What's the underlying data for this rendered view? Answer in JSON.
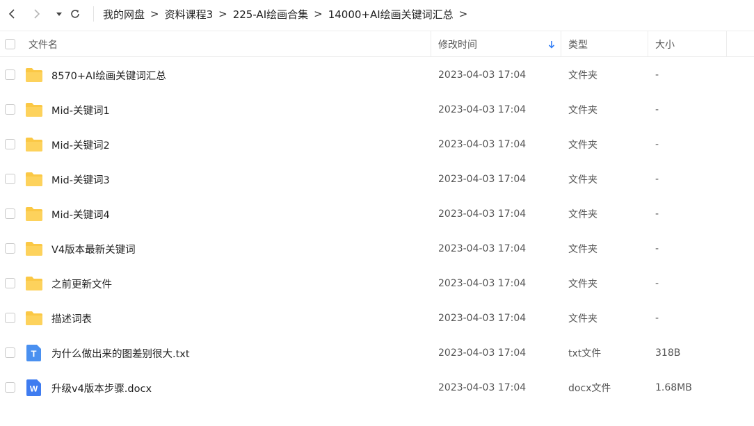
{
  "toolbar": {
    "back_icon": "chevron-left-icon",
    "forward_icon": "chevron-right-icon",
    "dropdown_icon": "caret-down-icon",
    "refresh_icon": "refresh-icon"
  },
  "breadcrumb": {
    "separator": ">",
    "items": [
      "我的网盘",
      "资料课程3",
      "225-AI绘画合集",
      "14000+AI绘画关键词汇总"
    ]
  },
  "columns": {
    "name": "文件名",
    "modified": "修改时间",
    "type": "类型",
    "size": "大小",
    "sort_icon": "arrow-down-icon"
  },
  "colors": {
    "folder": "#fbc845",
    "txt_icon": "#4a90f0",
    "docx_icon": "#3f7cf0",
    "sort_arrow": "#2f7cf6"
  },
  "files": [
    {
      "name": "8570+AI绘画关键词汇总",
      "modified": "2023-04-03 17:04",
      "type": "文件夹",
      "size": "-",
      "icon": "folder-icon"
    },
    {
      "name": "Mid-关键词1",
      "modified": "2023-04-03 17:04",
      "type": "文件夹",
      "size": "-",
      "icon": "folder-icon"
    },
    {
      "name": "Mid-关键词2",
      "modified": "2023-04-03 17:04",
      "type": "文件夹",
      "size": "-",
      "icon": "folder-icon"
    },
    {
      "name": "Mid-关键词3",
      "modified": "2023-04-03 17:04",
      "type": "文件夹",
      "size": "-",
      "icon": "folder-icon"
    },
    {
      "name": "Mid-关键词4",
      "modified": "2023-04-03 17:04",
      "type": "文件夹",
      "size": "-",
      "icon": "folder-icon"
    },
    {
      "name": "V4版本最新关键词",
      "modified": "2023-04-03 17:04",
      "type": "文件夹",
      "size": "-",
      "icon": "folder-icon"
    },
    {
      "name": "之前更新文件",
      "modified": "2023-04-03 17:04",
      "type": "文件夹",
      "size": "-",
      "icon": "folder-icon"
    },
    {
      "name": "描述词表",
      "modified": "2023-04-03 17:04",
      "type": "文件夹",
      "size": "-",
      "icon": "folder-icon"
    },
    {
      "name": "为什么做出来的图差别很大.txt",
      "modified": "2023-04-03 17:04",
      "type": "txt文件",
      "size": "318B",
      "icon": "txt-file-icon",
      "icon_letter": "T"
    },
    {
      "name": "升级v4版本步骤.docx",
      "modified": "2023-04-03 17:04",
      "type": "docx文件",
      "size": "1.68MB",
      "icon": "docx-file-icon",
      "icon_letter": "W"
    }
  ]
}
